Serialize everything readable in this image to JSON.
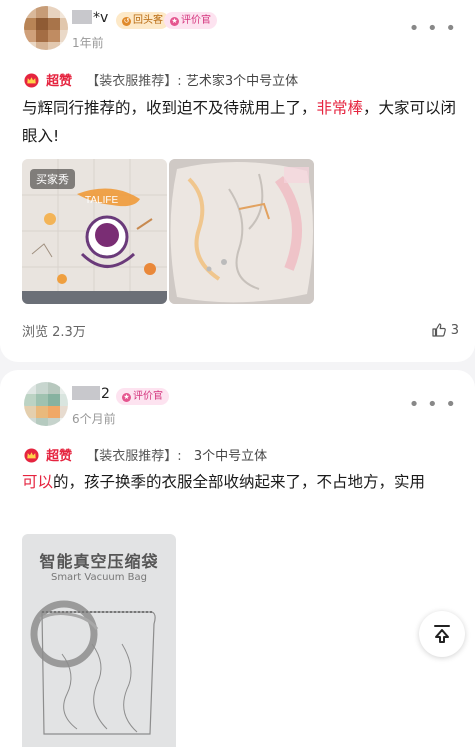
{
  "reviews": [
    {
      "user": {
        "name_suffix": "*v",
        "badges": [
          "回头客",
          "评价官"
        ],
        "time": "1年前"
      },
      "tag": {
        "rating": "超赞",
        "category": "【装衣服推荐】:",
        "product": "艺术家3个中号立体"
      },
      "content": {
        "part1": "与辉同行推荐的，收到迫不及待就用上了，",
        "highlight": "非常棒",
        "part2": "，大家可以闭眼入!"
      },
      "image_label": "买家秀",
      "views": "浏览 2.3万",
      "likes": "3"
    },
    {
      "user": {
        "name_suffix": "2",
        "badges": [
          "评价官"
        ],
        "time": "6个月前"
      },
      "tag": {
        "rating": "超赞",
        "category": "【装衣服推荐】:",
        "product": "3个中号立体"
      },
      "content": {
        "highlight": "可以",
        "part2": "的，孩子换季的衣服全部收纳起来了，不占地方，实用"
      },
      "image_text": {
        "title": "智能真空压缩袋",
        "subtitle": "Smart Vacuum Bag"
      }
    }
  ],
  "icons": {
    "more": "more-icon",
    "like": "thumb-up-icon",
    "scroll_top": "back-to-top-icon",
    "crown": "crown-icon"
  },
  "colors": {
    "accent": "#e5243f",
    "badge_orange": "#b86a10",
    "badge_pink": "#d4367e"
  }
}
